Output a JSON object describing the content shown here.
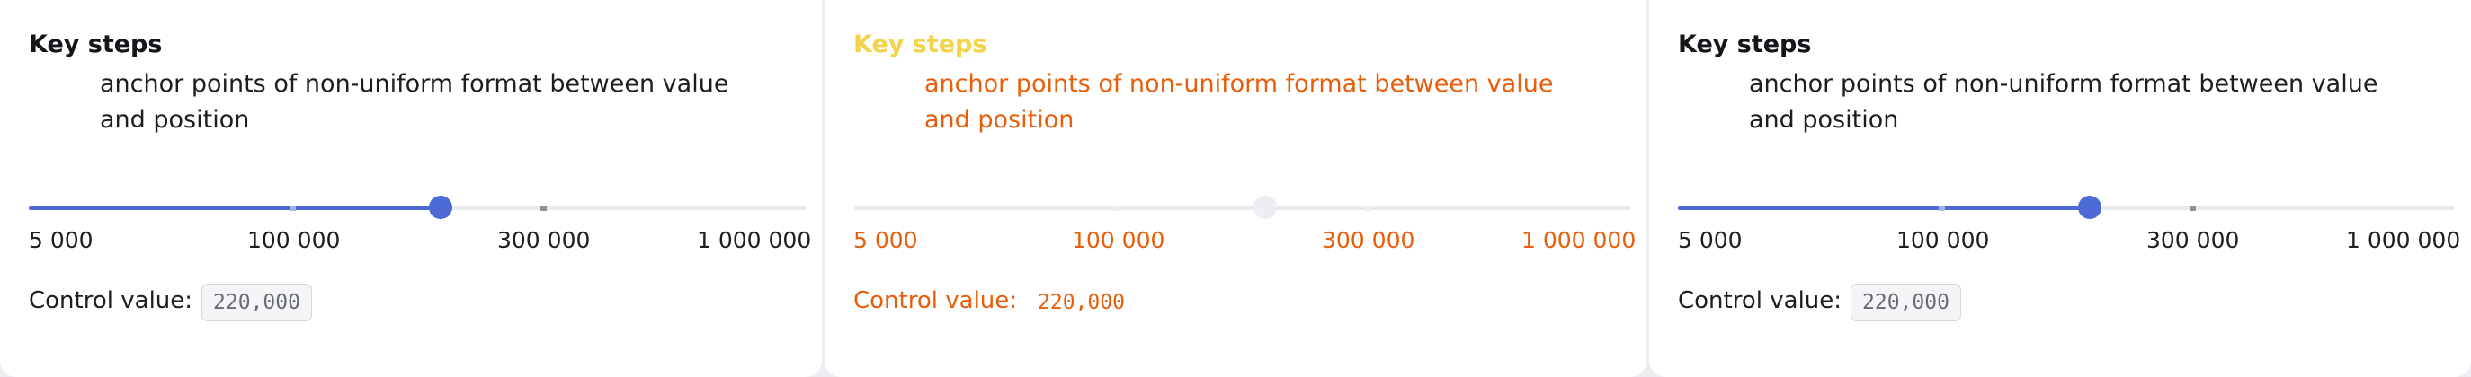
{
  "slider": {
    "title": "Key steps",
    "description": "anchor points of non-uniform format between value and position",
    "ticks": [
      "5 000",
      "100 000",
      "300 000",
      "1 000 000"
    ],
    "control_label": "Control value:",
    "control_value": "220,000",
    "value_fraction": 0.53
  }
}
